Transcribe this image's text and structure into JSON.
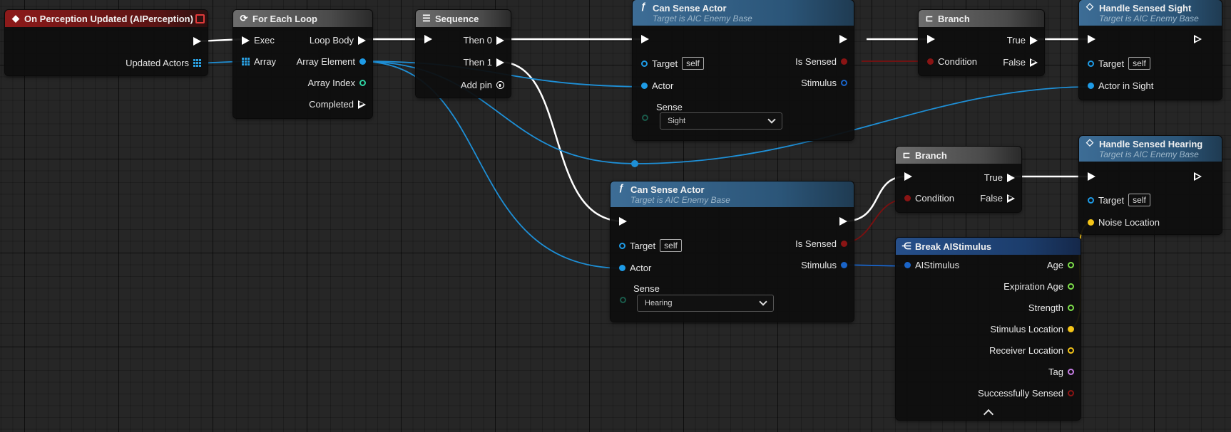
{
  "nodes": {
    "event": {
      "title": "On Perception Updated (AIPerception)",
      "pin_updated_actors": "Updated Actors"
    },
    "foreach": {
      "title": "For Each Loop",
      "exec": "Exec",
      "array": "Array",
      "loop_body": "Loop Body",
      "array_element": "Array Element",
      "array_index": "Array Index",
      "completed": "Completed"
    },
    "sequence": {
      "title": "Sequence",
      "then0": "Then 0",
      "then1": "Then 1",
      "add_pin": "Add pin"
    },
    "can_sense_sight": {
      "title": "Can Sense Actor",
      "subtitle": "Target is AIC Enemy Base",
      "target": "Target",
      "self": "self",
      "actor": "Actor",
      "sense": "Sense",
      "sense_value": "Sight",
      "is_sensed": "Is Sensed",
      "stimulus": "Stimulus"
    },
    "branch_top": {
      "title": "Branch",
      "condition": "Condition",
      "true": "True",
      "false": "False"
    },
    "handle_sight": {
      "title": "Handle Sensed Sight",
      "subtitle": "Target is AIC Enemy Base",
      "target": "Target",
      "self": "self",
      "actor_in_sight": "Actor in Sight"
    },
    "branch_bottom": {
      "title": "Branch",
      "condition": "Condition",
      "true": "True",
      "false": "False"
    },
    "handle_hearing": {
      "title": "Handle Sensed Hearing",
      "subtitle": "Target is AIC Enemy Base",
      "target": "Target",
      "self": "self",
      "noise_location": "Noise Location"
    },
    "can_sense_hearing": {
      "title": "Can Sense Actor",
      "subtitle": "Target is AIC Enemy Base",
      "target": "Target",
      "self": "self",
      "actor": "Actor",
      "sense": "Sense",
      "sense_value": "Hearing",
      "is_sensed": "Is Sensed",
      "stimulus": "Stimulus"
    },
    "break_stimulus": {
      "title": "Break AIStimulus",
      "in": "AIStimulus",
      "age": "Age",
      "expiration_age": "Expiration Age",
      "strength": "Strength",
      "stimulus_location": "Stimulus Location",
      "receiver_location": "Receiver Location",
      "tag": "Tag",
      "successfully_sensed": "Successfully Sensed"
    }
  },
  "colors": {
    "exec": "#ffffff",
    "object": "#1e9be6",
    "bool": "#9a1a1a",
    "int": "#2fd3a3",
    "float": "#7ee04a",
    "vector": "#f5c518",
    "name": "#c77ee6",
    "struct": "#1a64c8"
  },
  "icons": {
    "event": "event-diamond-icon",
    "foreach": "loop-icon",
    "sequence": "sequence-icon",
    "function": "function-f-icon",
    "branch": "branch-icon",
    "break": "break-struct-icon"
  }
}
